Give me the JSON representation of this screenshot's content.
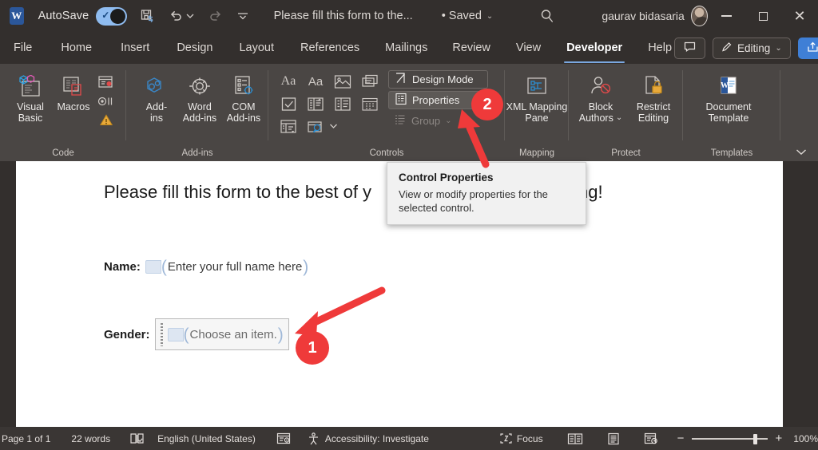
{
  "titlebar": {
    "app_icon": "word-logo",
    "autosave_label": "AutoSave",
    "autosave_state": "on",
    "save_icon": "save-refresh-icon",
    "undo_icon": "undo-icon",
    "redo_icon": "redo-icon",
    "customize_icon": "customize-quick-access-icon",
    "document_title": "Please fill this form to the...",
    "saved_status": "• Saved",
    "saved_chevron": "chevron-down-icon",
    "search_icon": "search-icon",
    "user_name": "gaurav bidasaria",
    "minimize": "minimize-icon",
    "maximize": "maximize-icon",
    "close": "close-icon"
  },
  "tabs": [
    {
      "label": "File",
      "active": false
    },
    {
      "label": "Home",
      "active": false
    },
    {
      "label": "Insert",
      "active": false
    },
    {
      "label": "Design",
      "active": false
    },
    {
      "label": "Layout",
      "active": false
    },
    {
      "label": "References",
      "active": false
    },
    {
      "label": "Mailings",
      "active": false
    },
    {
      "label": "Review",
      "active": false
    },
    {
      "label": "View",
      "active": false
    },
    {
      "label": "Developer",
      "active": true
    },
    {
      "label": "Help",
      "active": false
    }
  ],
  "tab_right": {
    "comments_icon": "comment-icon",
    "editing_label": "Editing",
    "editing_icon": "pencil-icon",
    "editing_chevron": "chevron-down-icon",
    "share_icon": "share-icon",
    "share_chevron": "chevron-down-icon"
  },
  "ribbon": {
    "groups": [
      {
        "name": "Code",
        "label": "Code"
      },
      {
        "name": "Add-ins",
        "label": "Add-ins"
      },
      {
        "name": "Controls",
        "label": "Controls"
      },
      {
        "name": "Mapping",
        "label": "Mapping"
      },
      {
        "name": "Protect",
        "label": "Protect"
      },
      {
        "name": "Templates",
        "label": "Templates"
      }
    ],
    "code": {
      "visual_basic": "Visual\nBasic",
      "visual_basic_line1": "Visual",
      "visual_basic_line2": "Basic",
      "macros": "Macros",
      "record_macro_icon": "record-macro-icon",
      "pause_recording_icon": "pause-recording-icon",
      "macro_security_icon": "macro-security-icon"
    },
    "addins": {
      "addins_line1": "Add-",
      "addins_line2": "ins",
      "word_line1": "Word",
      "word_line2": "Add-ins",
      "com_line1": "COM",
      "com_line2": "Add-ins"
    },
    "controls": {
      "icons": [
        "rich-text-content-control-icon",
        "plain-text-content-control-icon",
        "picture-content-control-icon",
        "building-block-gallery-icon",
        "check-box-content-control-icon",
        "combo-box-content-control-icon",
        "drop-down-list-content-control-icon",
        "date-picker-content-control-icon",
        "repeating-section-content-control-icon",
        "legacy-tools-icon"
      ],
      "legacy_chevron": "chevron-down-icon",
      "design_mode": "Design Mode",
      "design_mode_icon": "design-mode-icon",
      "properties": "Properties",
      "properties_icon": "properties-icon",
      "group": "Group",
      "group_icon": "group-icon",
      "group_chevron": "chevron-down-icon"
    },
    "mapping": {
      "line1": "XML Mapping",
      "line2": "Pane",
      "icon": "xml-mapping-pane-icon"
    },
    "protect": {
      "block_line1": "Block",
      "block_line2": "Authors",
      "block_chevron": "chevron-down-icon",
      "block_icon": "block-authors-icon",
      "restrict_line1": "Restrict",
      "restrict_line2": "Editing",
      "restrict_icon": "restrict-editing-lock-icon"
    },
    "templates": {
      "line1": "Document",
      "line2": "Template",
      "icon": "document-template-icon"
    },
    "collapse_chevron": "chevron-down-icon"
  },
  "tooltip": {
    "title": "Control Properties",
    "body": "View or modify properties for the selected control."
  },
  "document": {
    "heading": "Please fill this form to the best of your ability. Happy editing!",
    "heading_visible_left": "Please fill this form to the best of y",
    "heading_visible_right": "ting!",
    "fields": [
      {
        "label": "Name:",
        "control_text": "Enter your full name here",
        "control_type": "plain-text-content-control",
        "selected": false
      },
      {
        "label": "Gender:",
        "control_text": "Choose an item.",
        "control_type": "drop-down-list-content-control",
        "selected": true
      }
    ]
  },
  "annotations": [
    {
      "name": "step-1-marker",
      "number": "1"
    },
    {
      "name": "step-2-marker",
      "number": "2"
    }
  ],
  "statusbar": {
    "page": "Page 1 of 1",
    "words": "22 words",
    "proofing_icon": "proofing-errors-icon",
    "language": "English (United States)",
    "dictate_icon": "text-predictions-icon",
    "accessibility": "Accessibility: Investigate",
    "accessibility_icon": "accessibility-icon",
    "focus": "Focus",
    "focus_icon": "focus-mode-icon",
    "read_mode_icon": "read-mode-icon",
    "print_layout_icon": "print-layout-icon",
    "web_layout_icon": "web-layout-icon",
    "zoom_out": "−",
    "zoom_in": "+",
    "zoom_level": "100%"
  },
  "colors": {
    "chrome": "#332f2d",
    "ribbon": "#4a4644",
    "accent_blue": "#3f7fd6",
    "annotation_red": "#ef3a3a",
    "tab_underline": "#7aa7e0"
  }
}
